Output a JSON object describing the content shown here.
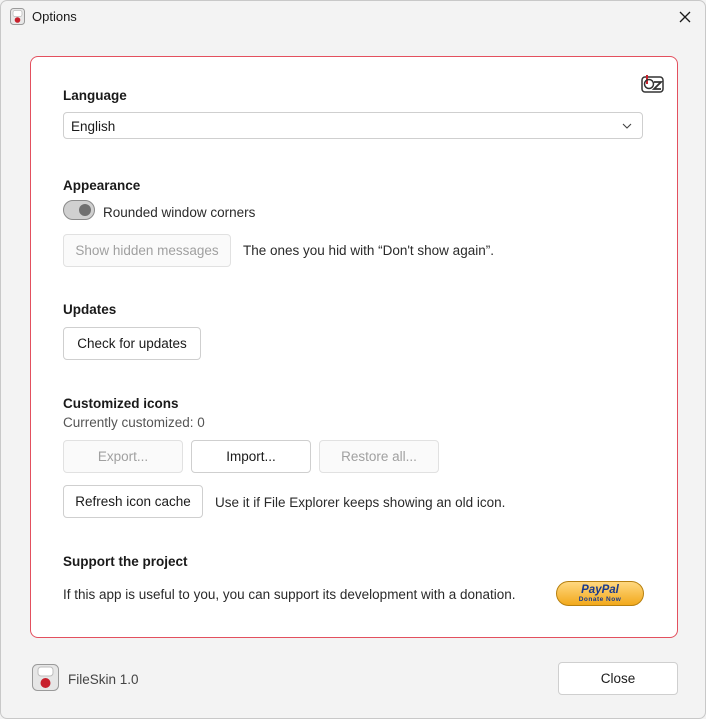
{
  "window": {
    "title": "Options",
    "icon": "fileskin-app-icon",
    "close_icon": "close-icon"
  },
  "language": {
    "title": "Language",
    "selected": "English",
    "dropdown_icon": "chevron-down-icon"
  },
  "appearance": {
    "title": "Appearance",
    "rounded_corners_label": "Rounded window corners",
    "rounded_corners_on": true,
    "show_hidden_label": "Show hidden messages",
    "show_hidden_hint": "The ones you hid with “Don't show again”."
  },
  "updates": {
    "title": "Updates",
    "check_label": "Check for updates"
  },
  "customized_icons": {
    "title": "Customized icons",
    "count_text": "Currently customized: 0",
    "export_label": "Export...",
    "import_label": "Import...",
    "restore_label": "Restore all...",
    "refresh_label": "Refresh icon cache",
    "refresh_hint": "Use it if File Explorer keeps showing an old icon."
  },
  "support": {
    "title": "Support the project",
    "text": "If this app is useful to you, you can support its development with a donation.",
    "paypal_label": "PayPal",
    "paypal_sub": "Donate Now"
  },
  "footer": {
    "app_version": "FileSkin 1.0",
    "close_label": "Close"
  },
  "colors": {
    "accent_border": "#e3505e",
    "paypal_gold": "#f2a91c",
    "paypal_blue": "#1a3a8c"
  }
}
